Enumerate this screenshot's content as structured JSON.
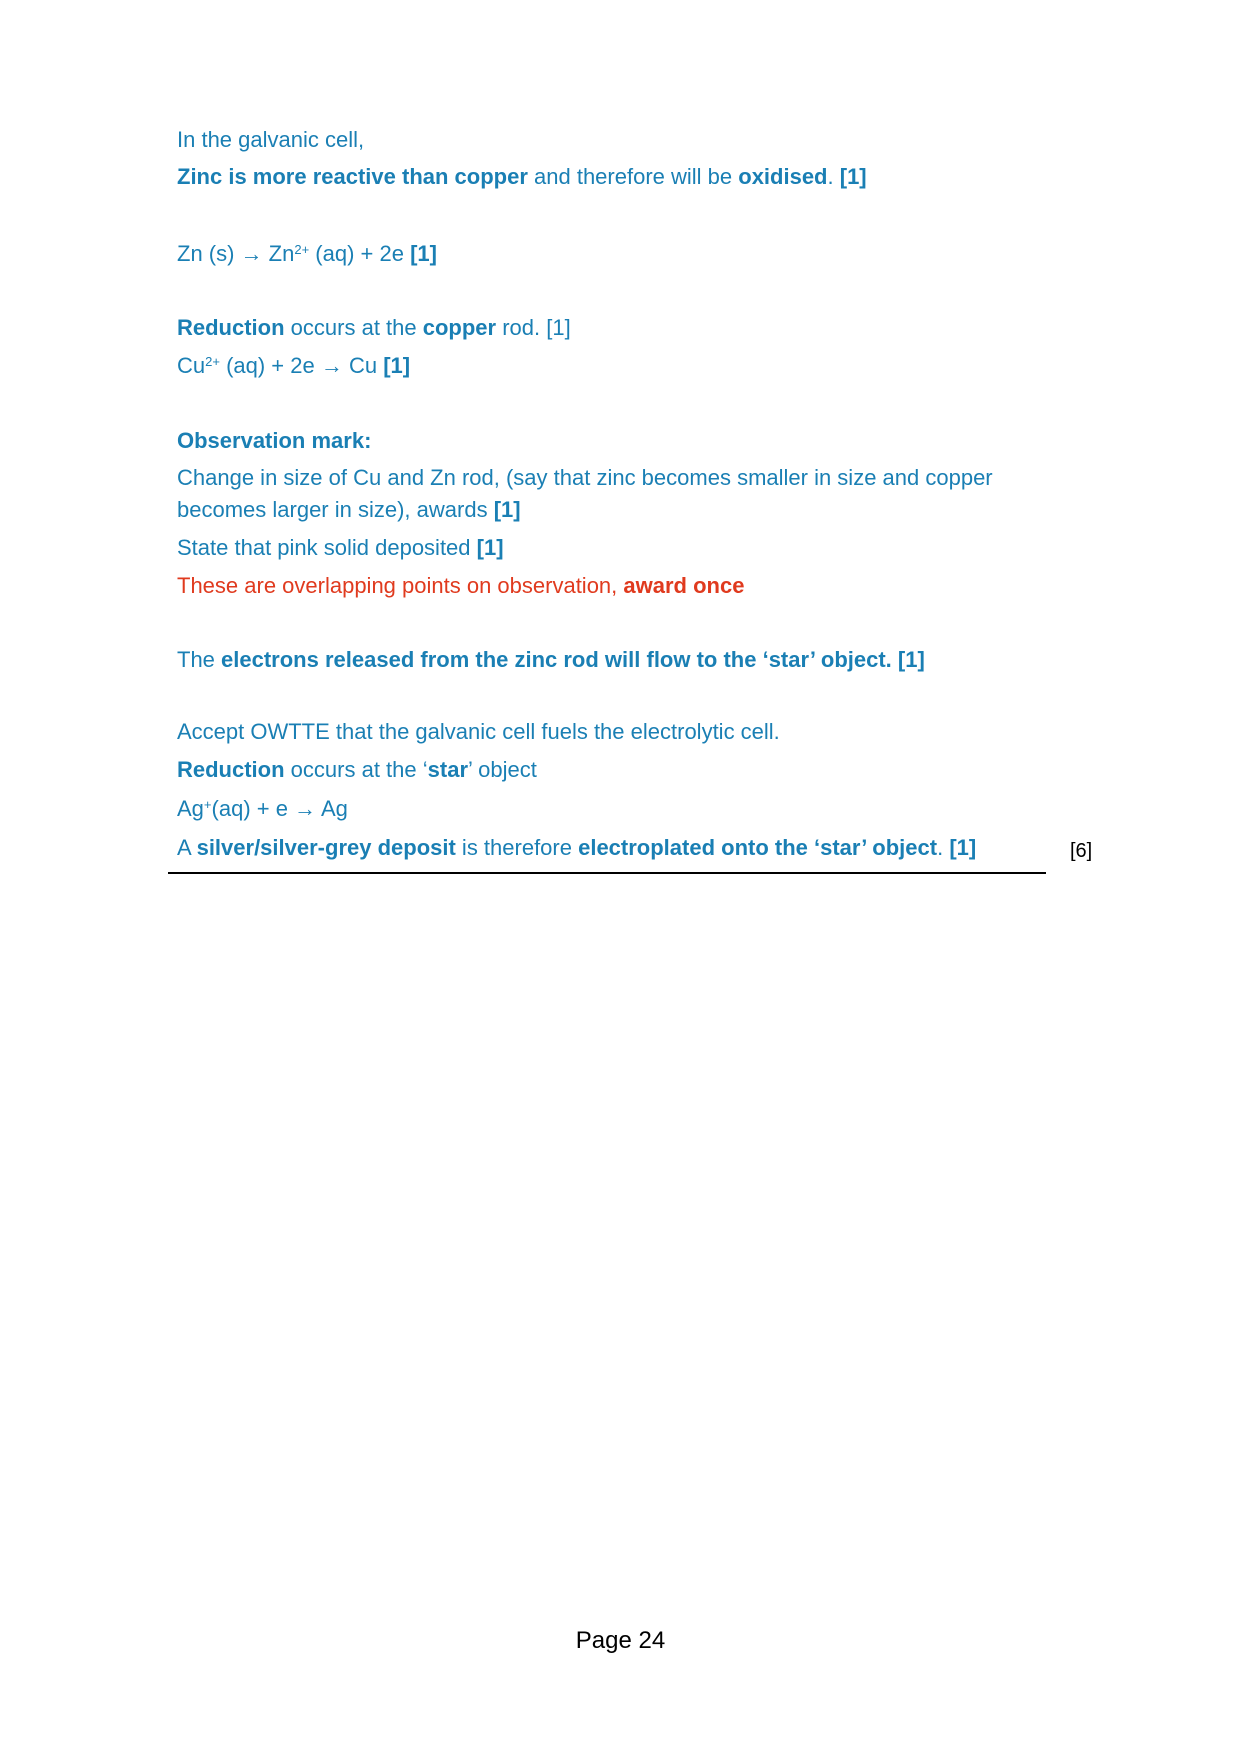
{
  "colors": {
    "text_blue": "#1a7fb4",
    "text_red": "#e03a1e",
    "rule": "#000000"
  },
  "galvanic": {
    "intro": "In the galvanic cell,",
    "zinc_reactive": "Zinc is more reactive than copper",
    "oxidised_mid": " and therefore will be ",
    "oxidised": "oxidised",
    "oxidised_end": ".",
    "mark": "[1]",
    "zn_eq_a": "Zn (s) → Zn",
    "zn_eq_sup": "2+",
    "zn_eq_b": " (aq) + 2e ",
    "zn_eq_mark": "[1]"
  },
  "reduction": {
    "word": "Reduction",
    "mid": " occurs at the ",
    "copper": "copper",
    "end": " rod. [1]",
    "cu_eq_a": "Cu",
    "cu_eq_sup": "2+",
    "cu_eq_b": " (aq) + 2e → Cu ",
    "cu_eq_mark": "[1]"
  },
  "observation": {
    "heading": "Observation mark:",
    "line1": "Change in size of Cu and Zn rod, (say that zinc becomes smaller in size and copper",
    "line2": "becomes larger in size), awards ",
    "line2_mark": "[1]",
    "pink": "State that pink solid deposited ",
    "pink_mark": "[1]",
    "note": "These are overlapping points on observation, ",
    "note_bold": "award once"
  },
  "electrons": {
    "lead": "The ",
    "bold": "electrons released from the zinc rod will flow to the ‘star’ object. [1]"
  },
  "electrolytic": {
    "accept": "Accept OWTTE that the galvanic cell fuels the electrolytic cell.",
    "reduction": "Reduction",
    "red_mid": " occurs at the ‘",
    "star": "star",
    "red_end": "’ object",
    "ag_a": "Ag",
    "ag_sup": "+",
    "ag_b": "(aq) + e → Ag",
    "final_a": "A ",
    "final_deposit": "silver/silver-grey deposit",
    "final_mid": " is therefore ",
    "final_bold": "electroplated onto the ‘star’ object",
    "final_dot": ". ",
    "final_mark": "[1]"
  },
  "marks_total": "[6]",
  "footer": {
    "page": "Page 24"
  }
}
